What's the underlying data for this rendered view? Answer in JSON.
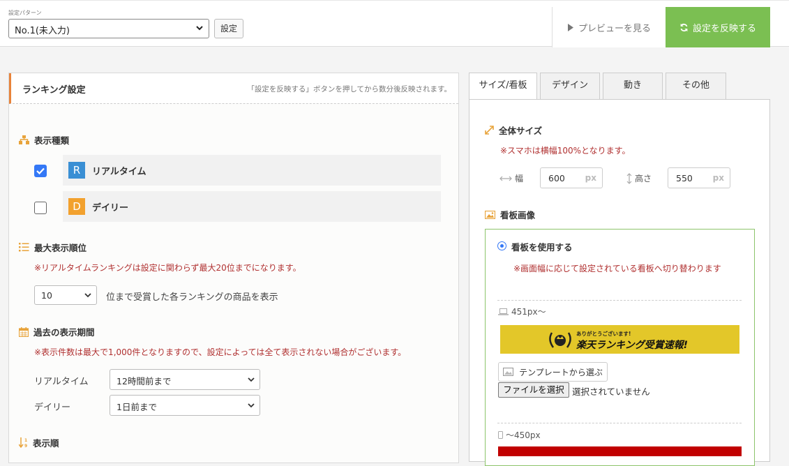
{
  "topbar": {
    "pattern_label": "設定パターン",
    "pattern_value": "No.1(未入力)",
    "set_label": "設定",
    "preview_label": "プレビューを見る",
    "apply_label": "設定を反映する",
    "apply_color": "#7bbf52"
  },
  "left": {
    "title": "ランキング設定",
    "note": "「設定を反映する」ボタンを押してから数分後反映されます。",
    "display_type": {
      "title": "表示種類",
      "items": [
        {
          "badge": "R",
          "label": "リアルタイム",
          "checked": true,
          "badge_color": "#3a8fd4"
        },
        {
          "badge": "D",
          "label": "デイリー",
          "checked": false,
          "badge_color": "#f2a12e"
        }
      ]
    },
    "max_rank": {
      "title": "最大表示順位",
      "warning": "※リアルタイムランキングは設定に関わらず最大20位までになります。",
      "value": "10",
      "suffix": "位まで受賞した各ランキングの商品を表示"
    },
    "period": {
      "title": "過去の表示期間",
      "warning": "※表示件数は最大で1,000件となりますので、設定によっては全て表示されない場合がございます。",
      "realtime_label": "リアルタイム",
      "realtime_value": "12時間前まで",
      "daily_label": "デイリー",
      "daily_value": "1日前まで"
    },
    "order": {
      "title": "表示順"
    }
  },
  "tabs": [
    {
      "label": "サイズ/看板",
      "active": true
    },
    {
      "label": "デザイン",
      "active": false
    },
    {
      "label": "動き",
      "active": false
    },
    {
      "label": "その他",
      "active": false
    }
  ],
  "right": {
    "size": {
      "title": "全体サイズ",
      "warning": "※スマホは横幅100%となります。",
      "width_label": "幅",
      "width_value": "600",
      "height_label": "高さ",
      "height_value": "550",
      "unit": "px"
    },
    "billboard": {
      "title": "看板画像",
      "use_label": "看板を使用する",
      "use_selected": true,
      "warning": "※画面幅に応じて設定されている看板へ切り替わります",
      "large_label": "451px〜",
      "banner_small_text": "ありがとうございます!",
      "banner_big_text": "楽天ランキング受賞速報!",
      "template_label": "テンプレートから選ぶ",
      "file_button_label": "ファイルを選択",
      "file_status": "選択されていません",
      "small_label": "〜450px"
    }
  },
  "colors": {
    "accent_orange": "#e8833a",
    "warning_red": "#b03030",
    "checkbox_blue": "#3478f6",
    "box_green": "#8cc46a"
  }
}
